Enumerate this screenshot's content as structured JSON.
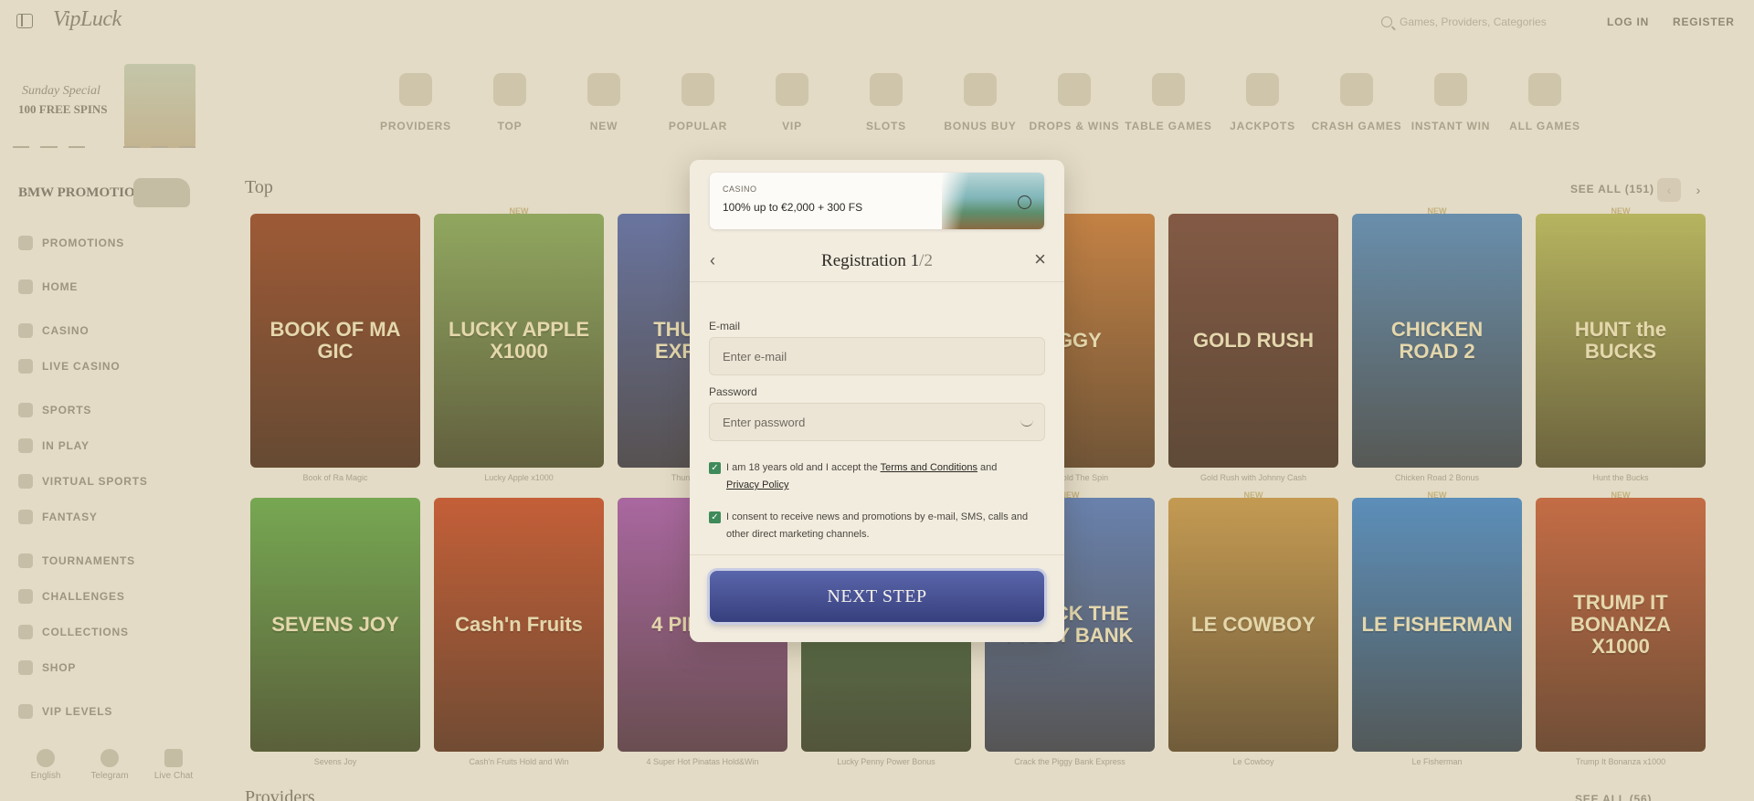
{
  "header": {
    "logo": "VipLuck",
    "search_placeholder": "Games, Providers, Categories",
    "login": "LOG IN",
    "register": "REGISTER"
  },
  "sidebar": {
    "promo": {
      "line1": "Sunday Special",
      "line2": "100 FREE SPINS"
    },
    "bmw": "BMW PROMOTION",
    "items": [
      {
        "label": "PROMOTIONS"
      },
      {
        "label": "HOME"
      },
      {
        "label": "CASINO"
      },
      {
        "label": "LIVE CASINO"
      },
      {
        "label": "SPORTS"
      },
      {
        "label": "IN PLAY"
      },
      {
        "label": "VIRTUAL SPORTS"
      },
      {
        "label": "FANTASY"
      },
      {
        "label": "TOURNAMENTS"
      },
      {
        "label": "CHALLENGES"
      },
      {
        "label": "COLLECTIONS"
      },
      {
        "label": "SHOP"
      },
      {
        "label": "VIP LEVELS"
      }
    ],
    "bottom": [
      {
        "label": "English",
        "icon": "flag-uk-icon"
      },
      {
        "label": "Telegram",
        "icon": "telegram-icon"
      },
      {
        "label": "Live Chat",
        "icon": "chat-icon"
      }
    ]
  },
  "categories": [
    {
      "label": "PROVIDERS"
    },
    {
      "label": "TOP"
    },
    {
      "label": "NEW"
    },
    {
      "label": "POPULAR"
    },
    {
      "label": "VIP"
    },
    {
      "label": "SLOTS"
    },
    {
      "label": "BONUS BUY"
    },
    {
      "label": "DROPS & WINS"
    },
    {
      "label": "TABLE GAMES"
    },
    {
      "label": "JACKPOTS"
    },
    {
      "label": "CRASH GAMES"
    },
    {
      "label": "INSTANT WIN"
    },
    {
      "label": "ALL GAMES"
    }
  ],
  "section": {
    "title": "Top",
    "see_all": "SEE ALL (151)",
    "providers_title": "Providers",
    "providers_see_all": "SEE ALL (56)"
  },
  "games_row1": [
    {
      "title": "BOOK OF MA GIC",
      "caption": "Book of Ra Magic",
      "new": "",
      "color": "#9a4a28"
    },
    {
      "title": "LUCKY APPLE X1000",
      "caption": "Lucky Apple x1000",
      "new": "NEW",
      "color": "#8aa85a"
    },
    {
      "title": "THUNDER EXPRESS",
      "caption": "Thunder Express",
      "new": "",
      "color": "#5a6aa8"
    },
    {
      "title": "",
      "caption": "",
      "new": "",
      "color": "#a8883a"
    },
    {
      "title": "PIGGY",
      "caption": "Piggy: Hold The Spin",
      "new": "",
      "color": "#c87a3a"
    },
    {
      "title": "GOLD RUSH",
      "caption": "Gold Rush with Johnny Cash",
      "new": "",
      "color": "#7a4a3a"
    },
    {
      "title": "CHICKEN ROAD 2",
      "caption": "Chicken Road 2 Bonus",
      "new": "NEW",
      "color": "#5a8ab8"
    },
    {
      "title": "HUNT the BUCKS",
      "caption": "Hunt the Bucks",
      "new": "NEW",
      "color": "#b8b85a"
    }
  ],
  "games_row2": [
    {
      "title": "SEVENS JOY",
      "caption": "Sevens Joy",
      "new": "",
      "color": "#6aa84a"
    },
    {
      "title": "Cash'n Fruits",
      "caption": "Cash'n Fruits Hold and Win",
      "new": "",
      "color": "#c8502a"
    },
    {
      "title": "4 PINATAS",
      "caption": "4 Super Hot Pinatas Hold&Win",
      "new": "",
      "color": "#a85aa8"
    },
    {
      "title": "",
      "caption": "Lucky Penny Power Bonus",
      "new": "",
      "color": "#4a7a4a"
    },
    {
      "title": "CRACK THE PIGGY BANK",
      "caption": "Crack the Piggy Bank Express",
      "new": "NEW",
      "color": "#5a7ab8"
    },
    {
      "title": "LE COWBOY",
      "caption": "Le Cowboy",
      "new": "NEW",
      "color": "#c8984a"
    },
    {
      "title": "LE FISHERMAN",
      "caption": "Le Fisherman",
      "new": "NEW",
      "color": "#4a8ac8"
    },
    {
      "title": "TRUMP IT BONANZA X1000",
      "caption": "Trump It Bonanza x1000",
      "new": "NEW",
      "color": "#c8603a"
    }
  ],
  "modal": {
    "bonus_tag": "CASINO",
    "bonus_text": "100% up to €2,000 + 300 FS",
    "title": "Registration 1",
    "title_step": "/2",
    "email_label": "E-mail",
    "email_placeholder": "Enter e-mail",
    "password_label": "Password",
    "password_placeholder": "Enter password",
    "terms_prefix": "I am 18 years old and I accept the ",
    "terms_link": "Terms and Conditions",
    "terms_and": " and",
    "privacy_link": "Privacy Policy",
    "consent": "I consent to receive news and promotions by e-mail, SMS, calls and other direct marketing channels.",
    "next_button": "NEXT STEP",
    "accent": "#3f4a8f"
  }
}
